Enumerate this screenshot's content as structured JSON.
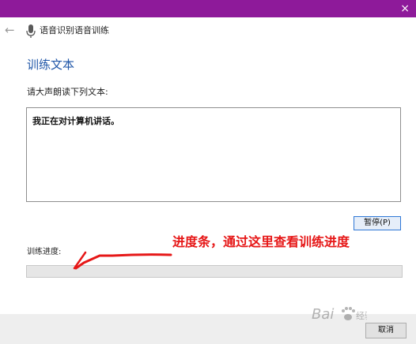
{
  "window": {
    "close_glyph": "×"
  },
  "header": {
    "back_icon": "back-arrow-icon",
    "mic_icon": "microphone-icon",
    "title": "语音识别语音训练"
  },
  "main": {
    "section_title": "训练文本",
    "instruction": "请大声朗读下列文本:",
    "training_text": "我正在对计算机讲话。",
    "pause_label": "暂停(P)",
    "progress_label": "训练进度:",
    "progress_fraction": 0
  },
  "annotation": {
    "text": "进度条，通过这里查看训练进度",
    "color": "#e61717"
  },
  "footer": {
    "cancel_label": "取消"
  },
  "colors": {
    "titlebar": "#8e1a9a",
    "title_text": "#1f56a8",
    "pause_border": "#2f78d6",
    "progress_fill": "#06b025",
    "annotation": "#e61717"
  },
  "watermark": {
    "text": "Baidu"
  }
}
